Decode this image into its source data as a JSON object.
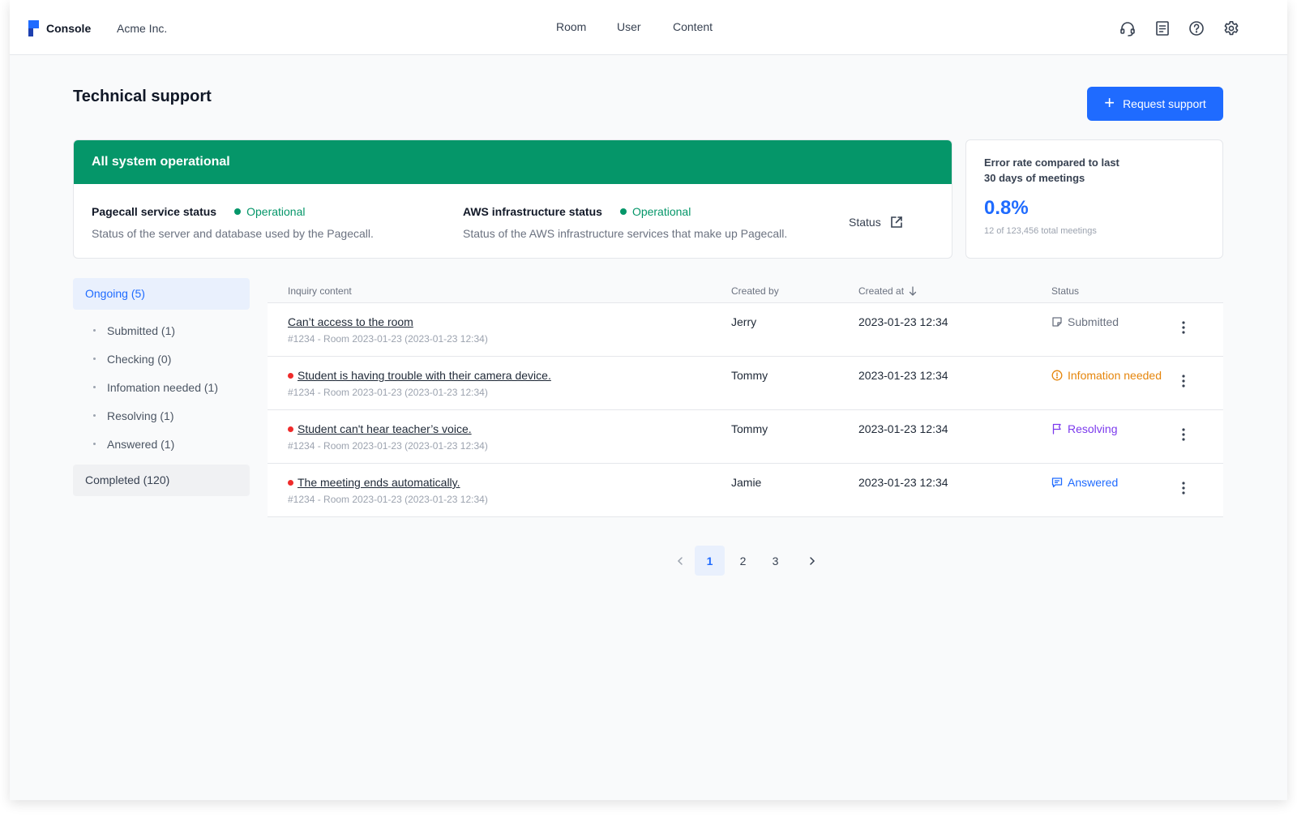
{
  "app": {
    "logo_label": "Console",
    "org_name": "Acme Inc."
  },
  "nav": {
    "items": [
      {
        "label": "Room"
      },
      {
        "label": "User"
      },
      {
        "label": "Content"
      }
    ]
  },
  "toolbar_icons": [
    "headset-icon",
    "document-icon",
    "help-icon",
    "gear-icon"
  ],
  "page": {
    "title": "Technical support",
    "request_button": "Request support"
  },
  "system_status": {
    "banner": "All system operational",
    "services": [
      {
        "title": "Pagecall service status",
        "state": "Operational",
        "description": "Status of the server and database used by the Pagecall."
      },
      {
        "title": "AWS infrastructure status",
        "state": "Operational",
        "description": "Status of the AWS infrastructure services that make up Pagecall."
      }
    ],
    "status_link": "Status"
  },
  "error_rate": {
    "title": "Error rate compared to last 30 days of meetings",
    "value": "0.8%",
    "subtitle": "12 of 123,456 total meetings"
  },
  "filters": {
    "ongoing": "Ongoing (5)",
    "ongoing_items": [
      "Submitted (1)",
      "Checking (0)",
      "Infomation needed (1)",
      "Resolving (1)",
      "Answered (1)"
    ],
    "completed": "Completed (120)"
  },
  "table": {
    "headers": {
      "content": "Inquiry content",
      "created_by": "Created by",
      "created_at": "Created at",
      "status": "Status"
    },
    "rows": [
      {
        "title": "Can’t access to the room",
        "unread": false,
        "meta": "#1234 - Room 2023-01-23 (2023-01-23 12:34)",
        "created_by": "Jerry",
        "created_at": "2023-01-23 12:34",
        "status": "Submitted",
        "status_color": "#6b7280",
        "status_icon": "note-icon"
      },
      {
        "title": "Student is having trouble with their camera device.",
        "unread": true,
        "meta": "#1234 - Room 2023-01-23 (2023-01-23 12:34)",
        "created_by": "Tommy",
        "created_at": "2023-01-23 12:34",
        "status": "Infomation needed",
        "status_color": "#e5850b",
        "status_icon": "alert-circle-icon"
      },
      {
        "title": "Student can't hear teacher’s voice.",
        "unread": true,
        "meta": "#1234 - Room 2023-01-23 (2023-01-23 12:34)",
        "created_by": "Tommy",
        "created_at": "2023-01-23 12:34",
        "status": "Resolving",
        "status_color": "#7c3aed",
        "status_icon": "flag-icon"
      },
      {
        "title": "The meeting ends automatically.",
        "unread": true,
        "meta": "#1234 - Room 2023-01-23 (2023-01-23 12:34)",
        "created_by": "Jamie",
        "created_at": "2023-01-23 12:34",
        "status": "Answered",
        "status_color": "#1f6bff",
        "status_icon": "message-icon"
      }
    ]
  },
  "pagination": {
    "pages": [
      "1",
      "2",
      "3"
    ],
    "current": "1"
  },
  "colors": {
    "accent": "#1f6bff",
    "operational": "#059669",
    "unread_dot": "#ef2b2b"
  }
}
